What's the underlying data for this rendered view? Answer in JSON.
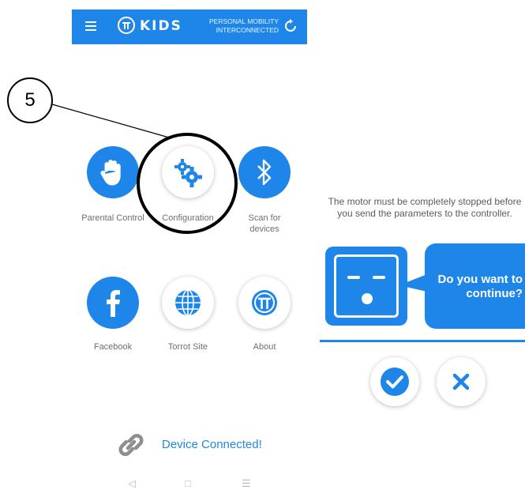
{
  "header": {
    "menu_icon": "hamburger-icon",
    "brand": "KIDS",
    "tagline_line1": "PERSONAL MOBILITY",
    "tagline_line2": "INTERCONNECTED",
    "status_icon": "sync-icon",
    "color": "#1e86e8"
  },
  "annotation": {
    "step_number": "5"
  },
  "menu": [
    {
      "label": "Parental Control",
      "icon": "hand-icon",
      "style": "blue"
    },
    {
      "label": "Configuration",
      "icon": "gears-icon",
      "style": "white"
    },
    {
      "label": "Scan for devices",
      "icon": "bluetooth-icon",
      "style": "blue"
    },
    {
      "label": "Facebook",
      "icon": "facebook-icon",
      "style": "blue"
    },
    {
      "label": "Torrot Site",
      "icon": "globe-icon",
      "style": "white"
    },
    {
      "label": "About",
      "icon": "torrot-logo-icon",
      "style": "white"
    }
  ],
  "status": {
    "text": "Device Connected!",
    "icon": "link-icon"
  },
  "android_nav": {
    "back": "◁",
    "home": "□",
    "recents": "☰"
  },
  "dialog": {
    "message": "The motor must be completely stopped before you send the parameters to the controller.",
    "question": "Do you want to continue?",
    "confirm_icon": "check-icon",
    "cancel_icon": "close-icon"
  }
}
